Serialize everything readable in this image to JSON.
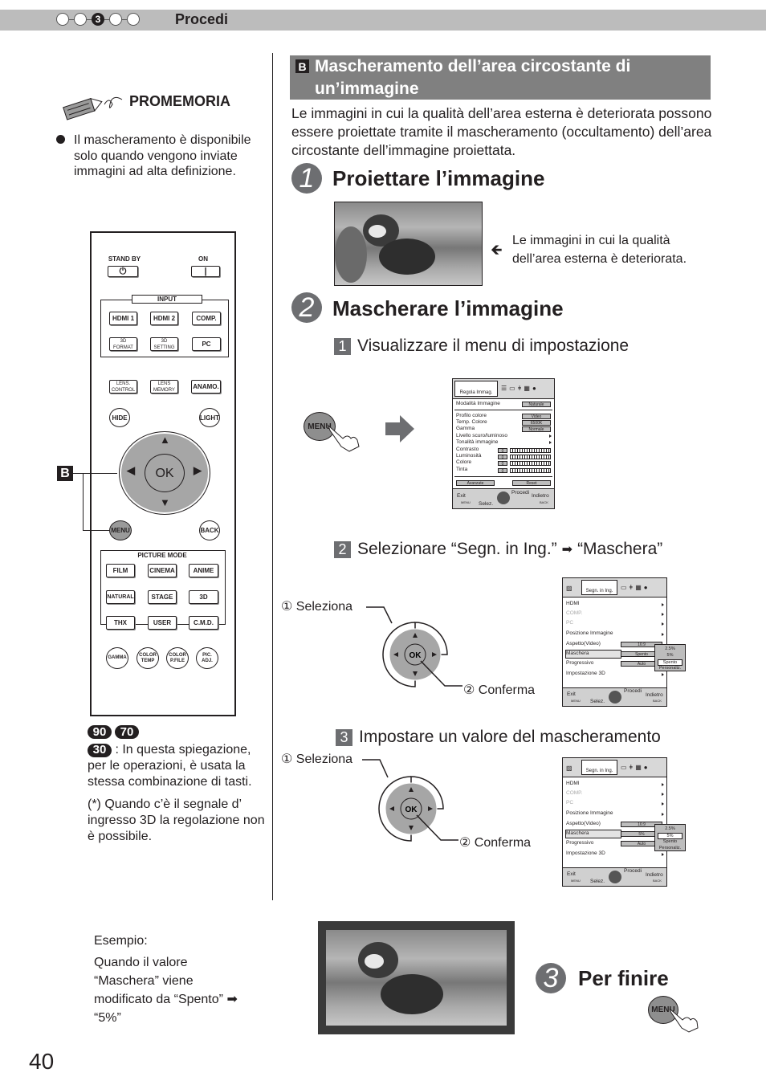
{
  "header": {
    "steps": [
      "",
      "",
      "3",
      "",
      ""
    ],
    "active_step": 3,
    "title": "Procedi"
  },
  "memo": {
    "title": "PROMEMORIA",
    "text": "Il mascheramento è disponibile solo quando vengono inviate immagini ad alta definizione."
  },
  "remote": {
    "standby_label": "STAND BY",
    "on_label": "ON",
    "input_label": "INPUT",
    "buttons_row1": [
      "HDMI 1",
      "HDMI 2",
      "COMP."
    ],
    "buttons_row2": [
      "3D FORMAT",
      "3D SETTING",
      "PC"
    ],
    "buttons_row3": [
      "LENS. CONTROL",
      "LENS MEMORY",
      "ANAMO."
    ],
    "hide": "HIDE",
    "light": "LIGHT",
    "ok": "OK",
    "menu": "MENU",
    "back": "BACK",
    "picture_mode_label": "PICTURE MODE",
    "pm_row1": [
      "FILM",
      "CINEMA",
      "ANIME"
    ],
    "pm_row2": [
      "NATURAL",
      "STAGE",
      "3D"
    ],
    "pm_row3": [
      "THX",
      "USER",
      "C.M.D."
    ],
    "round_buttons": [
      "GAMMA",
      "COLOR TEMP",
      "COLOR P.FILE",
      "PIC. ADJ."
    ],
    "callout_badge": "B"
  },
  "models": {
    "badges": [
      "90",
      "70",
      "30"
    ],
    "note": ": In questa spiegazione, per le operazioni, è usata la stessa combinazione di tasti.",
    "note3d": "(*) Quando c’è il segnale d’ ingresso 3D la regolazione non è possibile."
  },
  "section": {
    "badge": "B",
    "title": "Mascheramento dell’area circostante di un’immagine",
    "intro": "Le immagini in cui la qualità dell’area esterna è deteriorata possono essere proiettate tramite il mascheramento (occultamento) dell’area circostante dell’immagine proiettata."
  },
  "step1": {
    "number": "1",
    "title": "Proiettare l’immagine",
    "caption": "Le immagini in cui la qualità dell’area esterna è deteriorata."
  },
  "step2": {
    "number": "2",
    "title": "Mascherare l’immagine",
    "sub1": {
      "number": "1",
      "label": "Visualizzare il menu di impostazione"
    },
    "sub2": {
      "number": "2",
      "label_a": "Selezionare “Segn. in Ing.”",
      "label_b": "“Maschera”"
    },
    "sub3": {
      "number": "3",
      "label": "Impostare un valore del mascheramento"
    },
    "menu_key": "MENU",
    "select_label": "① Seleziona",
    "confirm_label": "② Conferma",
    "ok_label": "OK"
  },
  "osd_picture": {
    "tab": "Regola Immag.",
    "rows": [
      {
        "label": "Modalità Immagine",
        "value": "Naturale"
      },
      {
        "label": "Profilo colore",
        "value": "Video"
      },
      {
        "label": "Temp. Colore",
        "value": "6500K"
      },
      {
        "label": "Gamma",
        "value": "Normale"
      },
      {
        "label": "Livello scuro/luminoso",
        "value": ""
      },
      {
        "label": "Tonalità immagine",
        "value": ""
      },
      {
        "label": "Contrasto",
        "value": "0"
      },
      {
        "label": "Luminosità",
        "value": "0"
      },
      {
        "label": "Colore",
        "value": "0"
      },
      {
        "label": "Tinta",
        "value": "0"
      }
    ],
    "advanced": "Avanzate",
    "reset": "Reset",
    "footer": {
      "exit": "Exit",
      "menu": "MENU",
      "select": "Selez.",
      "proceed": "Procedi",
      "back_label": "Indietro",
      "back": "BACK"
    }
  },
  "osd_signal_a": {
    "tab": "Segn. in Ing.",
    "rows": [
      {
        "label": "HDMI",
        "value": "",
        "disabled": false
      },
      {
        "label": "COMP.",
        "value": "",
        "disabled": true
      },
      {
        "label": "PC",
        "value": "",
        "disabled": true
      },
      {
        "label": "Posizione Immagine",
        "value": "",
        "disabled": false
      },
      {
        "label": "Aspetto(Video)",
        "value": "16:9",
        "disabled": false
      },
      {
        "label": "Maschera",
        "value": "Spento",
        "disabled": false
      },
      {
        "label": "Progressivo",
        "value": "Auto",
        "disabled": false
      },
      {
        "label": "Impostazione 3D",
        "value": "",
        "disabled": false
      }
    ],
    "popup": [
      "2.5%",
      "5%",
      "Spento",
      "Personaliz."
    ],
    "popup_selected": "Spento",
    "footer": {
      "exit": "Exit",
      "menu": "MENU",
      "select": "Selez.",
      "proceed": "Procedi",
      "back_label": "Indietro",
      "back": "BACK"
    }
  },
  "osd_signal_b": {
    "tab": "Segn. in Ing.",
    "rows": [
      {
        "label": "HDMI",
        "value": "",
        "disabled": false
      },
      {
        "label": "COMP.",
        "value": "",
        "disabled": true
      },
      {
        "label": "PC",
        "value": "",
        "disabled": true
      },
      {
        "label": "Posizione Immagine",
        "value": "",
        "disabled": false
      },
      {
        "label": "Aspetto(Video)",
        "value": "16:9",
        "disabled": false
      },
      {
        "label": "Maschera",
        "value": "5%",
        "disabled": false
      },
      {
        "label": "Progressivo",
        "value": "Auto",
        "disabled": false
      },
      {
        "label": "Impostazione 3D",
        "value": "",
        "disabled": false
      }
    ],
    "popup": [
      "2.5%",
      "5%",
      "Spento",
      "Personaliz."
    ],
    "popup_selected": "5%",
    "footer": {
      "exit": "Exit",
      "menu": "MENU",
      "select": "Selez.",
      "proceed": "Procedi",
      "back_label": "Indietro",
      "back": "BACK"
    }
  },
  "example": {
    "title": "Esempio:",
    "line1": "Quando il valore",
    "line2": "“Maschera” viene",
    "line3": "modificato da “Spento”",
    "line4": "“5%”"
  },
  "step3": {
    "number": "3",
    "title": "Per finire",
    "menu_key": "MENU"
  },
  "page_number": "40"
}
